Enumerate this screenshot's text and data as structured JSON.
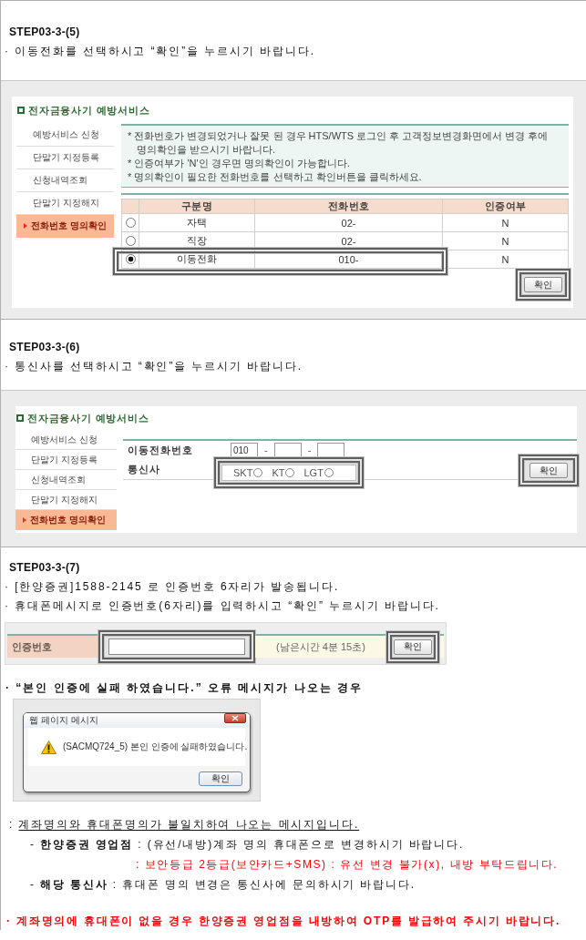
{
  "step_5": {
    "title": "STEP03-3-(5)",
    "lines": [
      "· 이동전화를 선택하시고 “확인”을 누르시기 바랍니다."
    ]
  },
  "panel_5": {
    "heading": "전자금융사기 예방서비스",
    "menu": [
      {
        "label": "예방서비스 신청",
        "selected": false
      },
      {
        "label": "단말기 지정등록",
        "selected": false
      },
      {
        "label": "신청내역조회",
        "selected": false
      },
      {
        "label": "단말기 지정해지",
        "selected": false
      },
      {
        "label": "전화번호 명의확인",
        "selected": true
      }
    ],
    "notices": [
      "* 전화번호가 변경되었거나 잘못 된 경우 HTS/WTS 로그인 후 고객정보변경화면에서 변경 후에 명의확인을 받으시기 바랍니다.",
      "* 인증여부가 'N'인 경우면 명의확인이 가능합니다.",
      "* 명의확인이 필요한 전화번호를 선택하고 확인버튼을 클릭하세요."
    ],
    "table": {
      "columns": [
        "구분명",
        "전화번호",
        "인증여부"
      ],
      "rows": [
        {
          "selected": false,
          "highlighted": false,
          "cells": [
            "자택",
            "02-",
            "N"
          ]
        },
        {
          "selected": false,
          "highlighted": false,
          "cells": [
            "직장",
            "02-",
            "N"
          ]
        },
        {
          "selected": true,
          "highlighted": true,
          "cells": [
            "이동전화",
            "010-",
            "N"
          ]
        }
      ]
    },
    "confirm_button": {
      "label": "확인",
      "highlighted": true
    }
  },
  "step_6": {
    "title": "STEP03-3-(6)",
    "lines": [
      "· 통신사를 선택하시고 “확인”을 누르시기 바랍니다."
    ]
  },
  "panel_6": {
    "heading": "전자금융사기 예방서비스",
    "menu": [
      {
        "label": "예방서비스 신청",
        "selected": false
      },
      {
        "label": "단말기 지정등록",
        "selected": false
      },
      {
        "label": "신청내역조회",
        "selected": false
      },
      {
        "label": "단말기 지정해지",
        "selected": false
      },
      {
        "label": "전화번호 명의확인",
        "selected": true
      }
    ],
    "fields": [
      {
        "kind": "phone",
        "label": "이동전화번호",
        "prefix": "010",
        "separators": [
          "-",
          "-"
        ]
      },
      {
        "kind": "carrier",
        "label": "통신사",
        "highlighted": true,
        "options": [
          {
            "label": "SKT",
            "selected": false
          },
          {
            "label": "KT",
            "selected": false
          },
          {
            "label": "LGT",
            "selected": false
          }
        ]
      }
    ],
    "confirm_button": {
      "label": "확인",
      "highlighted": true
    }
  },
  "step_7": {
    "title": "STEP03-3-(7)",
    "lines": [
      "· [한양증권]1588-2145 로 인증번호 6자리가 발송됩니다.",
      "· 휴대폰메시지로 인증번호(6자리)를 입력하시고 “확인” 누르시기 바랍니다."
    ]
  },
  "verification_form": {
    "label": "인증번호",
    "input": {
      "highlighted": true
    },
    "timer": "(남은시간 4분 15초)",
    "confirm_button": {
      "label": "확인",
      "highlighted": true
    }
  },
  "error_case": {
    "heading": "· “본인 인증에 실패 하였습니다.” 오류 메시지가 나오는 경우",
    "dialog": {
      "title": "웹 페이지 메시지",
      "message": "(SACMQ724_5) 본인 인증에 실패하였습니다.",
      "button": "확인"
    },
    "explanation": {
      "marker": ":",
      "text": "계좌명의와 휴대폰명의가 불일치하여 나오는 메시지입니다."
    },
    "notes": [
      {
        "kind": "contact",
        "text": "- **한양증권 영업점** : (유선/내방)계좌 명의 휴대폰으로 변경하시기 바랍니다."
      },
      {
        "kind": "warning",
        "text": ": 보안등급 2등급(보안카드+SMS) : 유선 변경 불가(x), 내방 부탁드립니다."
      },
      {
        "kind": "contact",
        "text": "- **해당 통신사** : 휴대폰 명의 변경은 통신사에 문의하시기 바랍니다."
      }
    ]
  },
  "final_note": "· 계좌명의에 휴대폰이 없을 경우 한양증권 영업점을 내방하여 OTP를 발급하여 주시기 바랍니다."
}
